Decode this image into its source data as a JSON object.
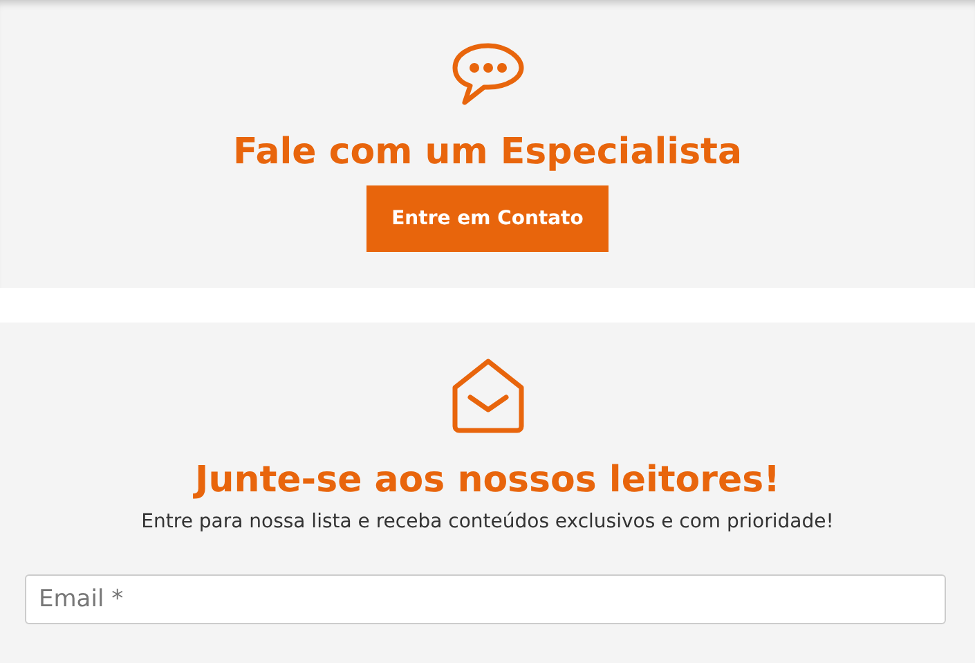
{
  "contact": {
    "title": "Fale com um Especialista",
    "button": "Entre em Contato"
  },
  "newsletter": {
    "title": "Junte-se aos nossos leitores!",
    "subtitle": "Entre para nossa lista e receba conteúdos exclusivos e com prioridade!",
    "email": {
      "placeholder": "Email *"
    }
  }
}
